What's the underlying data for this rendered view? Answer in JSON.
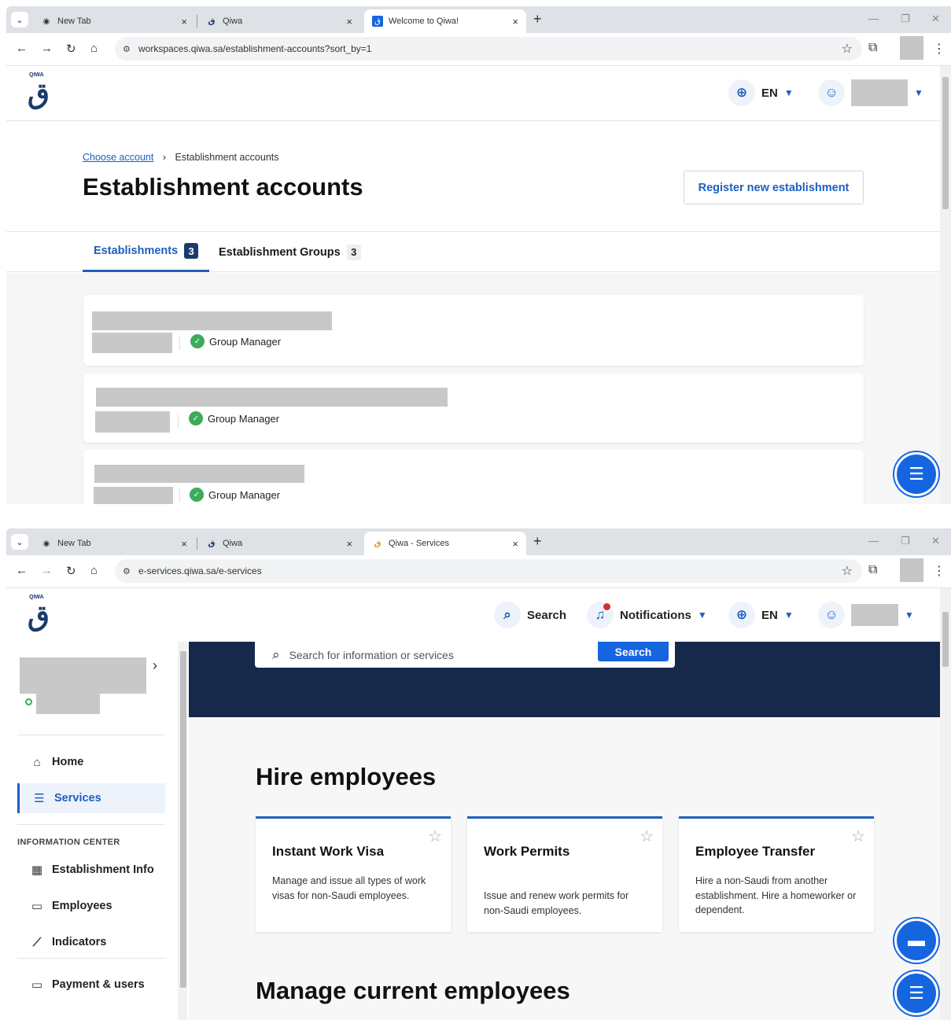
{
  "browser": {
    "tabs": [
      "New Tab",
      "Qiwa"
    ],
    "top_active_tab": "Welcome to Qiwa!",
    "bottom_active_tab": "Qiwa - Services",
    "top_url": "workspaces.qiwa.sa/establishment-accounts?sort_by=1",
    "bottom_url": "e-services.qiwa.sa/e-services"
  },
  "header": {
    "logo_small": "QIWA",
    "language": "EN",
    "search_label": "Search",
    "notifications_label": "Notifications"
  },
  "accounts_page": {
    "breadcrumb_link": "Choose account",
    "breadcrumb_current": "Establishment accounts",
    "title": "Establishment accounts",
    "register_button": "Register new establishment",
    "tabs": [
      {
        "label": "Establishments",
        "count": "3"
      },
      {
        "label": "Establishment Groups",
        "count": "3"
      }
    ],
    "cards": [
      {
        "role": "Group Manager"
      },
      {
        "role": "Group Manager"
      },
      {
        "role": "Group Manager"
      }
    ]
  },
  "services_page": {
    "search_placeholder": "Search for information or services",
    "search_button": "Search",
    "sidebar": {
      "home": "Home",
      "services": "Services",
      "section_label": "INFORMATION CENTER",
      "establishment_info": "Establishment Info",
      "employees": "Employees",
      "indicators": "Indicators",
      "payment_users": "Payment & users"
    },
    "section_hire": "Hire employees",
    "section_manage": "Manage current employees",
    "service_cards": [
      {
        "title": "Instant Work Visa",
        "desc": "Manage and issue all types of work visas for non-Saudi employees."
      },
      {
        "title": "Work Permits",
        "desc": "Issue and renew work permits for non-Saudi employees."
      },
      {
        "title": "Employee Transfer",
        "desc": "Hire a non-Saudi from another establishment. Hire a homeworker or dependent."
      }
    ]
  },
  "colors": {
    "primary": "#1e5fbf",
    "navy": "#16294a",
    "success": "#3cab5a"
  }
}
